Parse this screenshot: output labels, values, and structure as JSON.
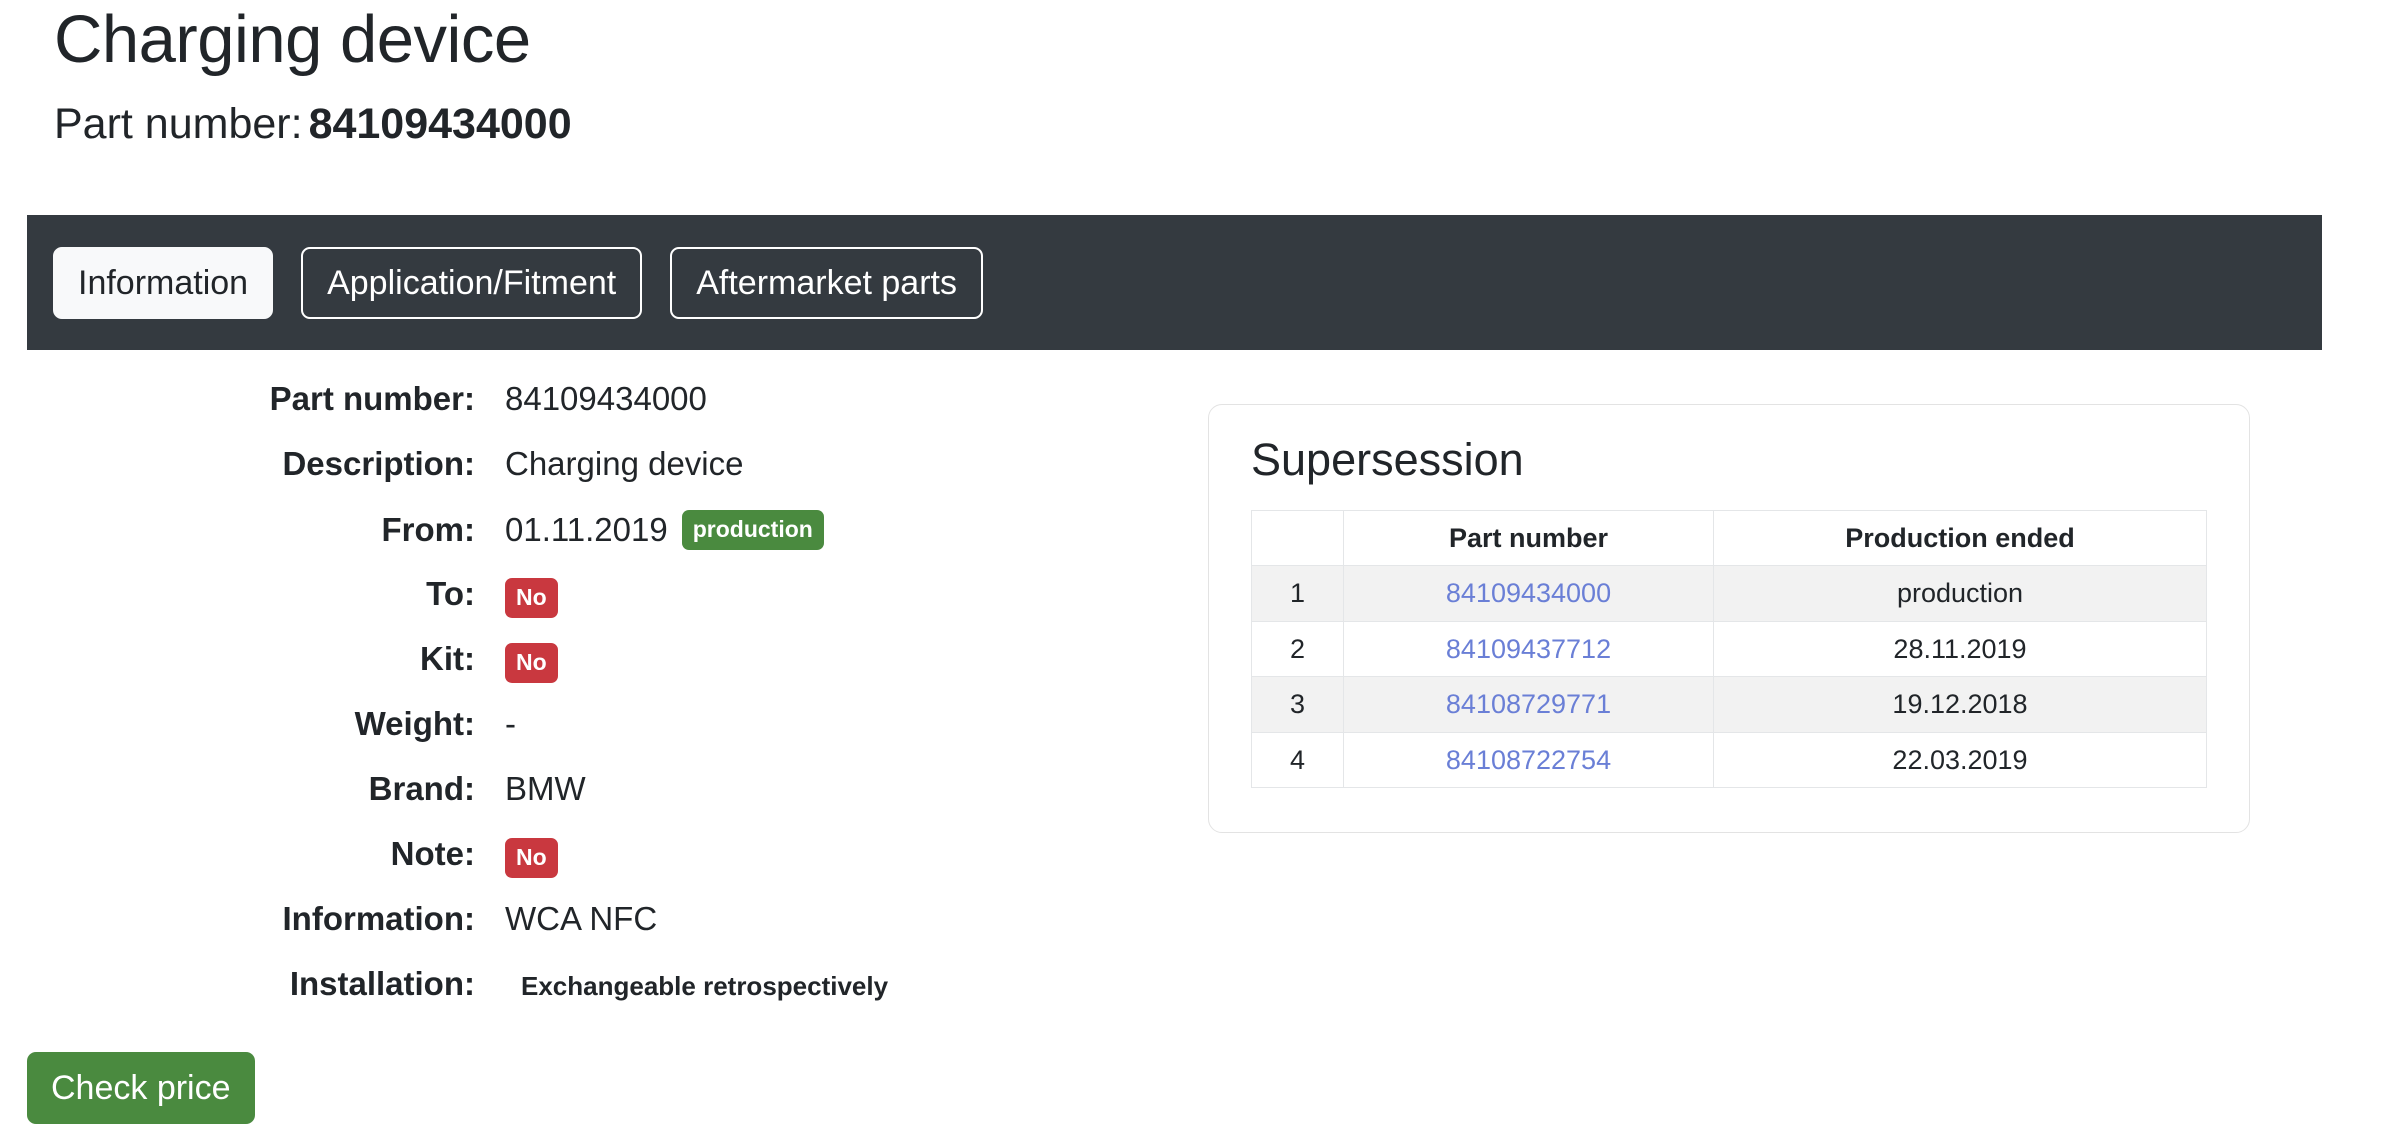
{
  "header": {
    "title": "Charging device",
    "partnumber_label": "Part number:",
    "partnumber_value": "84109434000"
  },
  "tabs": [
    {
      "label": "Information",
      "active": true
    },
    {
      "label": "Application/Fitment",
      "active": false
    },
    {
      "label": "Aftermarket parts",
      "active": false
    }
  ],
  "spec": {
    "rows": [
      {
        "label": "Part number:",
        "value": "84109434000"
      },
      {
        "label": "Description:",
        "value": "Charging device"
      },
      {
        "label": "From:",
        "value": "01.11.2019",
        "badge": "production"
      },
      {
        "label": "To:",
        "value": "",
        "badge": "No"
      },
      {
        "label": "Kit:",
        "value": "",
        "badge": "No"
      },
      {
        "label": "Weight:",
        "value": "-"
      },
      {
        "label": "Brand:",
        "value": "BMW"
      },
      {
        "label": "Note:",
        "value": "",
        "badge": "No"
      },
      {
        "label": "Information:",
        "value": "WCA NFC"
      },
      {
        "label": "Installation:",
        "value": "Exchangeable retrospectively"
      }
    ]
  },
  "actions": {
    "check_price_label": "Check price"
  },
  "supersession": {
    "title": "Supersession",
    "columns": [
      "",
      "Part number",
      "Production ended"
    ],
    "rows": [
      {
        "index": "1",
        "part_number": "84109434000",
        "production_ended": "production"
      },
      {
        "index": "2",
        "part_number": "84109437712",
        "production_ended": "28.11.2019"
      },
      {
        "index": "3",
        "part_number": "84108729771",
        "production_ended": "19.12.2018"
      },
      {
        "index": "4",
        "part_number": "84108722754",
        "production_ended": "22.03.2019"
      }
    ]
  },
  "colors": {
    "tabbar_bg": "#343a40",
    "badge_success": "#4a8a3f",
    "badge_danger": "#c9383f",
    "link": "#6a7fd6",
    "button_green": "#4a8a3f"
  }
}
